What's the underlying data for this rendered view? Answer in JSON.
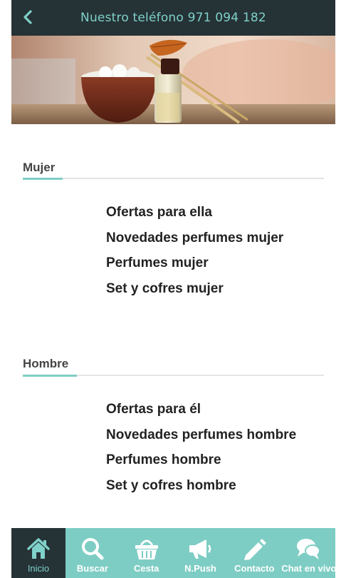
{
  "header": {
    "title": "Nuestro teléfono 971 094 182"
  },
  "sections": [
    {
      "title": "Mujer",
      "links": [
        "Ofertas para ella",
        "Novedades perfumes mujer",
        "Perfumes mujer",
        "Set y cofres mujer"
      ]
    },
    {
      "title": "Hombre",
      "links": [
        "Ofertas para él",
        "Novedades perfumes hombre",
        "Perfumes hombre",
        "Set y cofres hombre"
      ]
    }
  ],
  "tabbar": {
    "items": [
      {
        "label": "Inicio",
        "icon": "home-icon",
        "active": true
      },
      {
        "label": "Buscar",
        "icon": "search-icon",
        "active": false
      },
      {
        "label": "Cesta",
        "icon": "basket-icon",
        "active": false
      },
      {
        "label": "N.Push",
        "icon": "megaphone-icon",
        "active": false
      },
      {
        "label": "Contacto",
        "icon": "pencil-icon",
        "active": false
      },
      {
        "label": "Chat en vivo",
        "icon": "chat-icon",
        "active": false
      }
    ]
  },
  "colors": {
    "header_bg": "#253236",
    "accent": "#7ecdc4",
    "accent_text": "#7fd1c9",
    "link_text": "#222222"
  }
}
